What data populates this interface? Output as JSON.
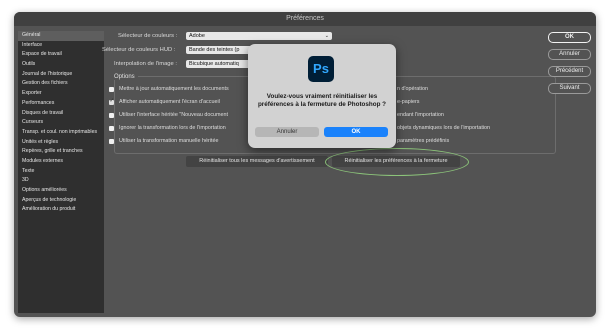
{
  "window": {
    "title": "Préférences"
  },
  "sidebar": {
    "items": [
      {
        "label": "Général",
        "active": true
      },
      {
        "label": "Interface"
      },
      {
        "label": "Espace de travail"
      },
      {
        "label": "Outils"
      },
      {
        "label": "Journal de l'historique"
      },
      {
        "label": "Gestion des fichiers"
      },
      {
        "label": "Exporter"
      },
      {
        "label": "Performances"
      },
      {
        "label": "Disques de travail"
      },
      {
        "label": "Curseurs"
      },
      {
        "label": "Transp. et coul. non imprimables"
      },
      {
        "label": "Unités et règles"
      },
      {
        "label": "Repères, grille et tranches"
      },
      {
        "label": "Modules externes"
      },
      {
        "label": "Texte"
      },
      {
        "label": "3D"
      },
      {
        "label": "Options améliorées"
      },
      {
        "label": "Aperçus de technologie"
      },
      {
        "label": "Amélioration du produit"
      }
    ]
  },
  "main": {
    "color_picker_label": "Sélecteur de couleurs :",
    "color_picker_value": "Adobe",
    "hud_picker_label": "Sélecteur de couleurs HUD :",
    "hud_picker_value": "Bande des teintes (p",
    "interpolation_label": "Interpolation de l'image :",
    "interpolation_value": "Bicubique automatiq",
    "options_title": "Options",
    "options_left": [
      {
        "label": "Mettre à jour automatiquement les documents",
        "checked": false
      },
      {
        "label": "Afficher automatiquement l'écran d'accueil",
        "checked": true
      },
      {
        "label": "Utiliser l'interface héritée \"Nouveau document",
        "checked": false
      },
      {
        "label": "Ignorer la transformation lors de l'importation",
        "checked": false
      },
      {
        "label": "Utiliser la transformation manuelle héritée",
        "checked": false
      }
    ],
    "options_right": [
      "n d'opération",
      "e-papiers",
      "endant l'importation",
      "objets dynamiques lors de l'importation",
      "paramètres prédéfinis"
    ],
    "reset_warnings_button": "Réinitialiser tous les messages d'avertissement",
    "reset_prefs_button": "Réinitialiser les préférences à la fermeture"
  },
  "buttons": {
    "ok": "OK",
    "cancel": "Annuler",
    "previous": "Précédent",
    "next": "Suivant"
  },
  "dialog": {
    "icon": "Ps",
    "message": "Voulez-vous vraiment réinitialiser les préférences à la fermeture de Photoshop ?",
    "cancel": "Annuler",
    "ok": "OK"
  },
  "colors": {
    "accent": "#1a82fb",
    "highlight_ring": "#8cc47a",
    "ps_icon_bg": "#001e36",
    "ps_icon_fg": "#31a8ff"
  }
}
